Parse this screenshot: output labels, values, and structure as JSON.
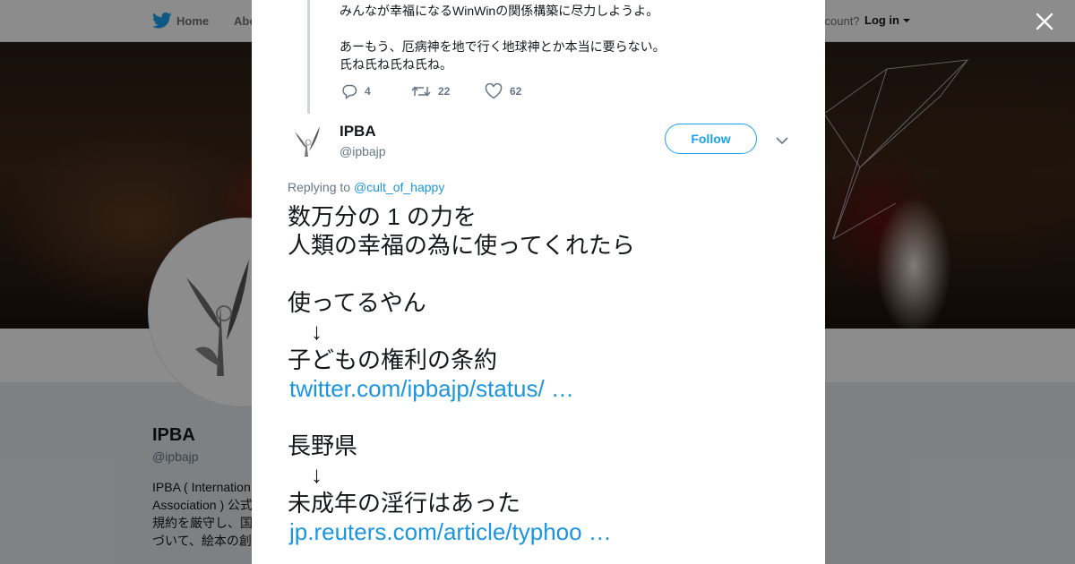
{
  "nav": {
    "home_label": "Home",
    "about_label": "Abo",
    "account_label": "ccount?",
    "login_label": "Log in"
  },
  "profile": {
    "name": "IPBA",
    "handle": "@ipbajp",
    "bio_lines": [
      "IPBA ( Internation",
      "Association ) 公式",
      "規約を厳守し、国",
      "づいて、絵本の創"
    ]
  },
  "modal": {
    "previous_tweet": {
      "lines": [
        "みんなが幸福になるWinWinの関係構築に尽力しようよ。",
        "",
        "あーもう、厄病神を地で行く地球神とか本当に要らない。",
        "氏ね氏ね氏ね氏ね。"
      ],
      "reply_count": "4",
      "retweet_count": "22",
      "like_count": "62"
    },
    "tweet": {
      "author_name": "IPBA",
      "author_handle": "@ipbajp",
      "follow_label": "Follow",
      "replying_prefix": "Replying to ",
      "replying_to": "@cult_of_happy",
      "lines": [
        "数万分の 1 の力を",
        "人類の幸福の為に使ってくれたら",
        "",
        "使ってるやん",
        "↓",
        "子どもの権利の条約",
        "twitter.com/ipbajp/status/ …",
        "",
        "長野県",
        "↓",
        "未成年の淫行はあった",
        "jp.reuters.com/article/typhoo …"
      ]
    }
  },
  "colors": {
    "twitter_blue": "#1da1f2",
    "link_blue": "#1b95e0",
    "text": "#14171a",
    "muted": "#657786"
  }
}
